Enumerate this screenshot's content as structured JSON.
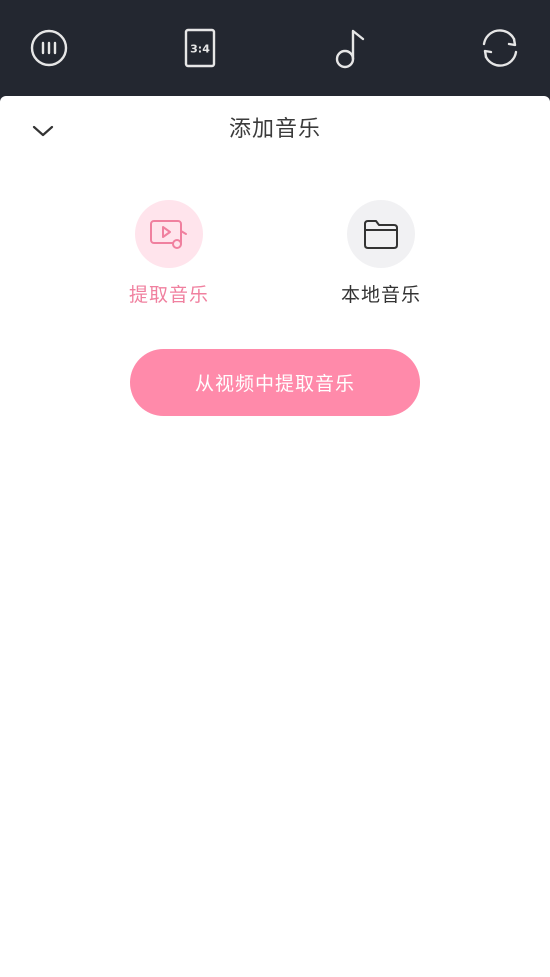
{
  "toolbar": {
    "icons": [
      "menu-circle-icon",
      "aspect-ratio-icon",
      "music-note-icon",
      "refresh-icon"
    ],
    "aspect_ratio_text": "3:4"
  },
  "sheet": {
    "title": "添加音乐",
    "collapse_icon": "chevron-down-icon",
    "options": [
      {
        "label": "提取音乐",
        "icon": "video-music-icon",
        "selected": true
      },
      {
        "label": "本地音乐",
        "icon": "folder-icon",
        "selected": false
      }
    ],
    "primary_button": "从视频中提取音乐"
  },
  "colors": {
    "toolbar_bg": "#232730",
    "accent_pink": "#f0809f",
    "button_pink": "#ff8aaa",
    "selected_circle_bg": "#ffe4ec",
    "unselected_circle_bg": "#f1f1f3"
  }
}
